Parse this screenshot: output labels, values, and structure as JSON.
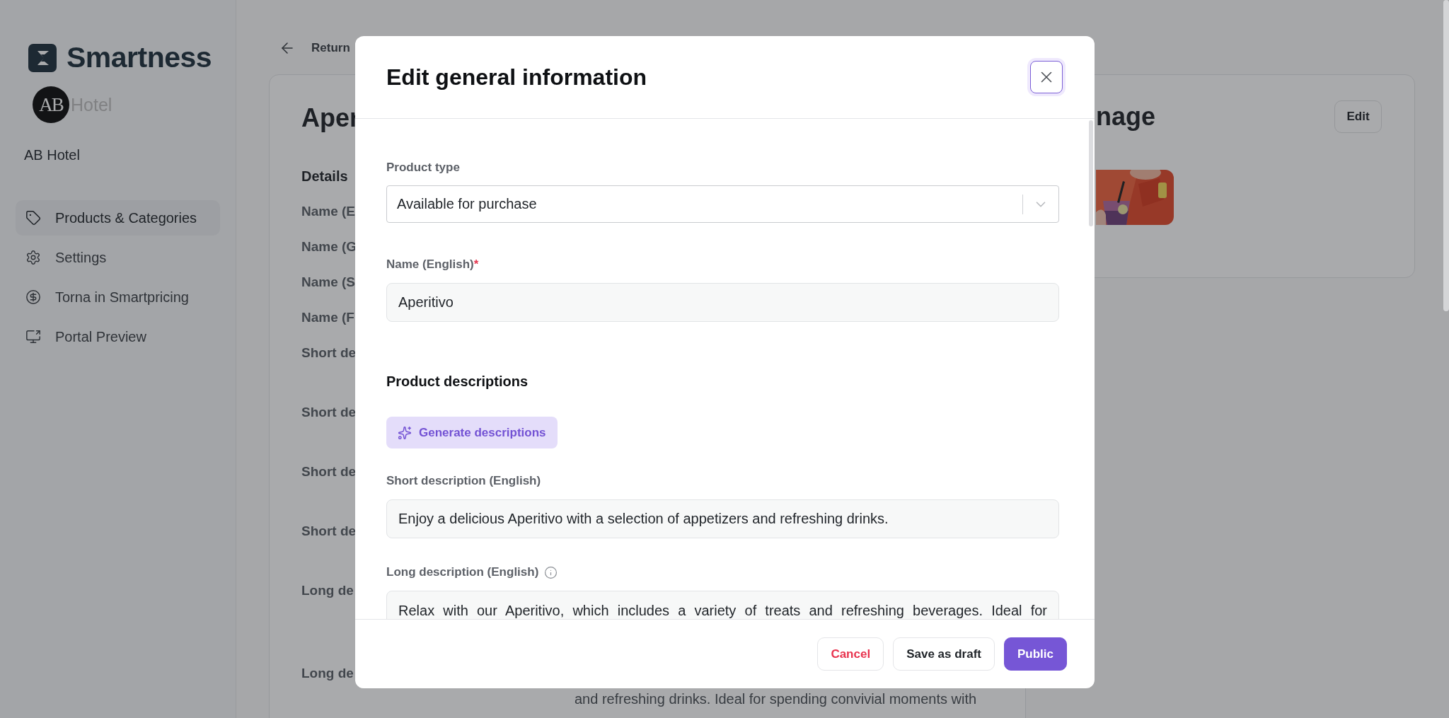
{
  "sidebar": {
    "brand": "Smartness",
    "hotel_logo": {
      "initials": "AB",
      "word": "Hotel"
    },
    "hotel_name": "AB Hotel",
    "items": [
      {
        "label": "Products & Categories",
        "selected": true
      },
      {
        "label": "Settings",
        "selected": false
      },
      {
        "label": "Torna in Smartpricing",
        "selected": false
      },
      {
        "label": "Portal Preview",
        "selected": false
      }
    ]
  },
  "main": {
    "back_link": "Return",
    "product_card": {
      "title": "Aper",
      "section": "Details",
      "fields": [
        {
          "label": "Name (E",
          "kind": "line"
        },
        {
          "label": "Name (G",
          "kind": "line"
        },
        {
          "label": "Name (S",
          "kind": "line"
        },
        {
          "label": "Name (F",
          "kind": "line"
        },
        {
          "label": "Short de",
          "kind": "block"
        },
        {
          "label": "Short de",
          "kind": "block"
        },
        {
          "label": "Short de",
          "kind": "block"
        },
        {
          "label": "Short de",
          "kind": "block"
        },
        {
          "label": "Long de",
          "kind": "long"
        },
        {
          "label": "Long de",
          "kind": "line"
        }
      ],
      "value_line": "and refreshing drinks. Ideal for spending convivial moments with"
    },
    "image_card": {
      "title": "nage",
      "edit": "Edit"
    }
  },
  "modal": {
    "title": "Edit general information",
    "product_type": {
      "label": "Product type",
      "value": "Available for purchase"
    },
    "name": {
      "label": "Name (English)",
      "required_mark": "*",
      "value": "Aperitivo"
    },
    "section": "Product descriptions",
    "generate": "Generate descriptions",
    "short_description": {
      "label": "Short description (English)",
      "value": "Enjoy a delicious Aperitivo with a selection of appetizers and refreshing drinks."
    },
    "long_description": {
      "label": "Long description (English)",
      "value": "Relax with our Aperitivo, which includes a variety of treats and refreshing beverages. Ideal for"
    },
    "buttons": [
      {
        "label": "Cancel",
        "kind": "danger"
      },
      {
        "label": "Save as draft",
        "kind": "secondary"
      },
      {
        "label": "Public",
        "kind": "primary"
      }
    ]
  }
}
